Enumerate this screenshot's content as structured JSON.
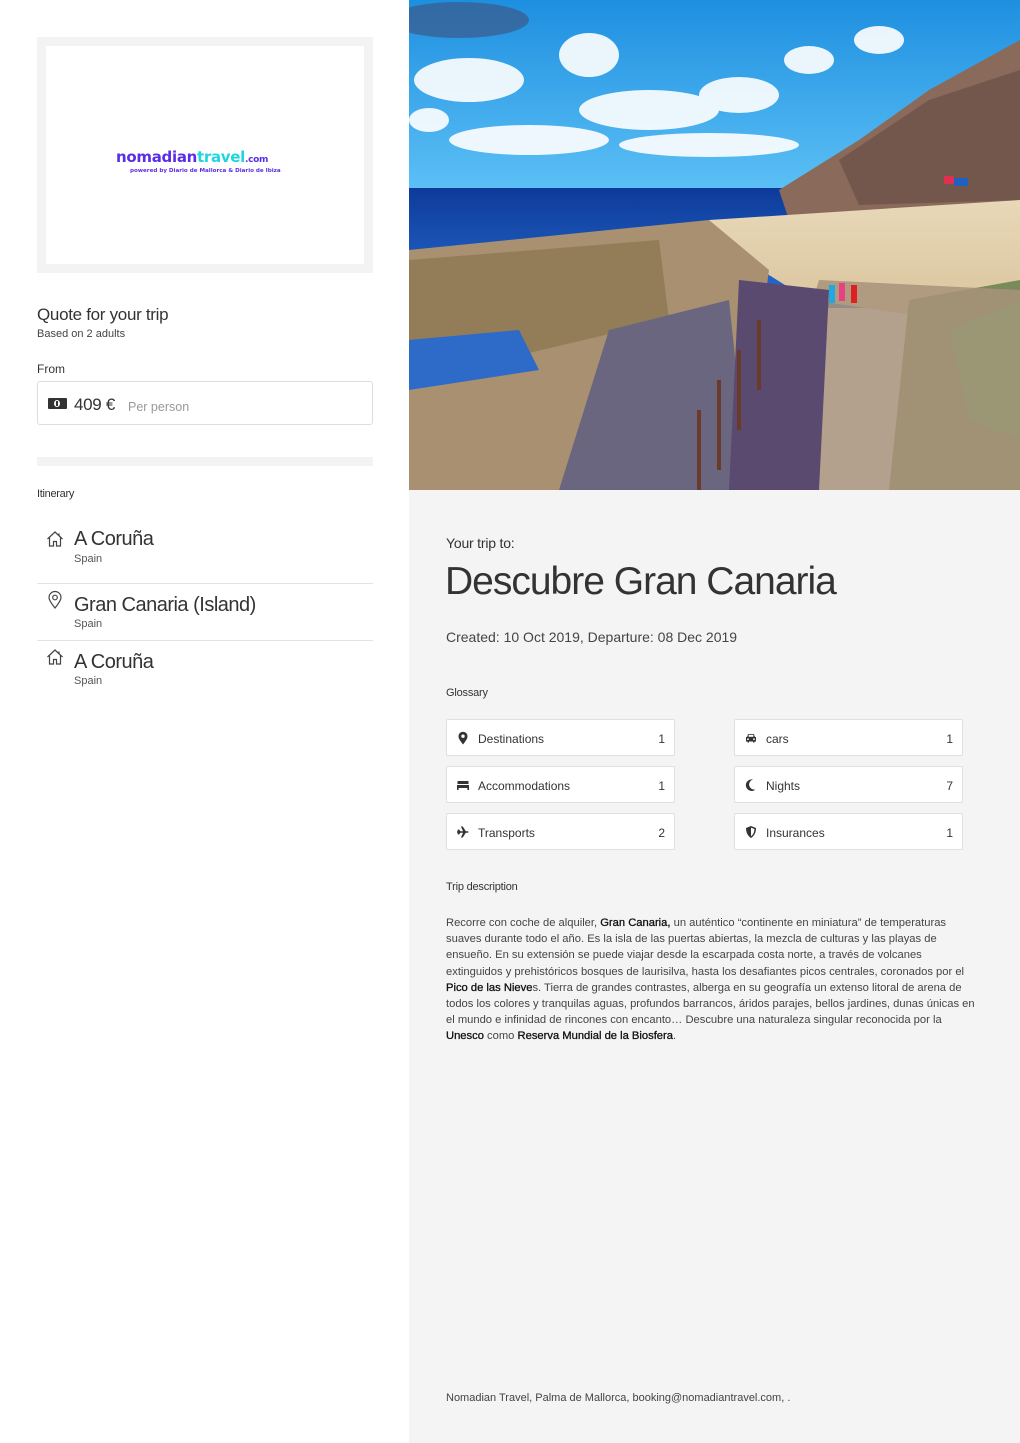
{
  "logo": {
    "part1": "nomadian",
    "part2": "travel",
    "part3": ".com",
    "tagline": "powered by Diario de Mallorca & Diario de Ibiza",
    "colors": {
      "primary": "#5a2ee6",
      "secondary": "#1fd6e0"
    }
  },
  "quote": {
    "title": "Quote for your trip",
    "subtitle": "Based on 2 adults",
    "from_label": "From",
    "price": "409 €",
    "price_unit": "Per person",
    "price_icon": "money-bill-icon"
  },
  "itinerary": {
    "label": "Itinerary",
    "items": [
      {
        "name": "A Coruña",
        "country": "Spain",
        "icon": "home-icon"
      },
      {
        "name": "Gran Canaria (Island)",
        "country": "Spain",
        "icon": "map-pin-icon"
      },
      {
        "name": "A Coruña",
        "country": "Spain",
        "icon": "home-icon"
      }
    ]
  },
  "trip": {
    "to_label": "Your trip to:",
    "title": "Descubre Gran Canaria",
    "dates": "Created: 10 Oct 2019, Departure: 08 Dec 2019"
  },
  "glossary": {
    "label": "Glossary",
    "items": [
      {
        "label": "Destinations",
        "count": "1",
        "icon": "map-marker-icon"
      },
      {
        "label": "cars",
        "count": "1",
        "icon": "car-icon"
      },
      {
        "label": "Accommodations",
        "count": "1",
        "icon": "bed-icon"
      },
      {
        "label": "Nights",
        "count": "7",
        "icon": "moon-icon"
      },
      {
        "label": "Transports",
        "count": "2",
        "icon": "plane-icon"
      },
      {
        "label": "Insurances",
        "count": "1",
        "icon": "shield-icon"
      }
    ]
  },
  "description": {
    "label": "Trip description",
    "segments": [
      {
        "text": " Recorre con coche de alquiler, ",
        "bold": false
      },
      {
        "text": "Gran Canaria,",
        "bold": true
      },
      {
        "text": " un auténtico “continente en miniatura” de temperaturas suaves durante todo el año. Es la isla de las puertas abiertas, la mezcla de culturas y las playas de ensueño. En su extensión se puede viajar desde la escarpada costa norte, a través de volcanes extinguidos y prehistóricos bosques de laurisilva, hasta los desafiantes picos centrales, coronados por el ",
        "bold": false
      },
      {
        "text": "Pico de las Nieve",
        "bold": true
      },
      {
        "text": "s. Tierra de grandes contrastes, alberga en su geografía un extenso litoral de arena de todos los colores y tranquilas aguas, profundos barrancos, áridos parajes, bellos jardines, dunas únicas en el mundo e infinidad de rincones con encanto… Descubre una naturaleza singular reconocida por la ",
        "bold": false
      },
      {
        "text": "Unesco",
        "bold": true
      },
      {
        "text": " como ",
        "bold": false
      },
      {
        "text": "Reserva Mundial de la Biosfera",
        "bold": true
      },
      {
        "text": ".",
        "bold": false
      }
    ]
  },
  "hero_image": {
    "alt": "Coastal path with stairs to a beach in Gran Canaria"
  },
  "footer": {
    "text": "Nomadian Travel, Palma de Mallorca, booking@nomadiantravel.com, ."
  }
}
